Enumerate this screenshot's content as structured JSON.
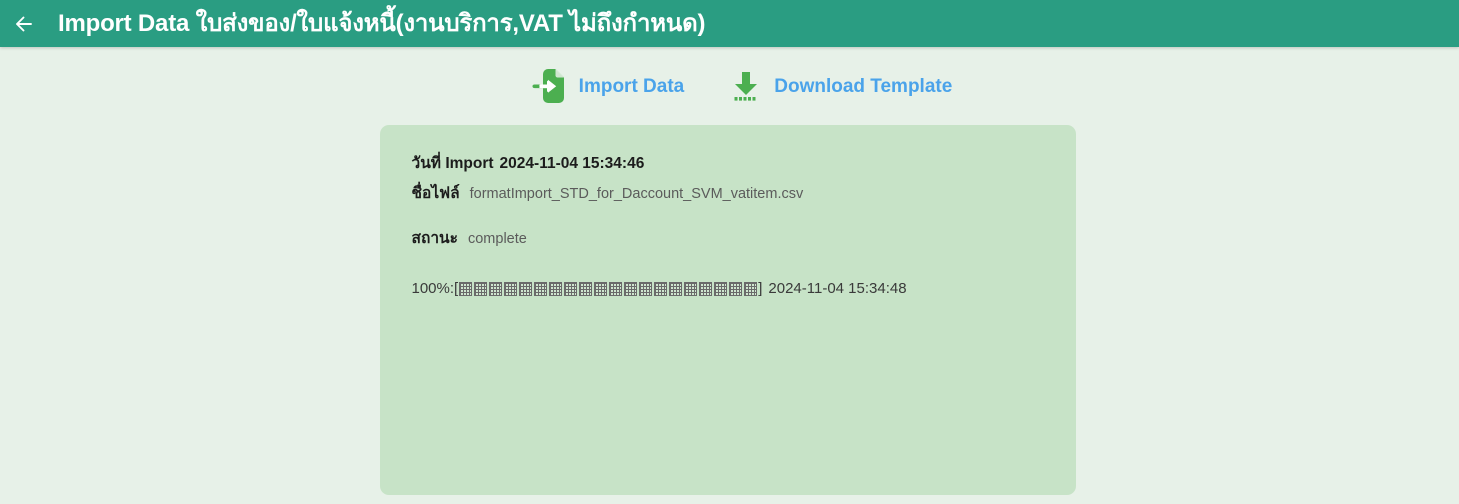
{
  "header": {
    "back_icon": "arrow-left-icon",
    "title": "Import Data ใบส่งของ/ใบแจ้งหนี้(งานบริการ,VAT ไม่ถึงกำหนด)",
    "background_color": "#2a9d82",
    "title_color": "#ffffff"
  },
  "toolbar": {
    "import": {
      "icon": "import-file-icon",
      "label": "Import Data"
    },
    "download": {
      "icon": "download-icon",
      "label": "Download Template"
    },
    "label_color": "#4aa3ea",
    "icon_color": "#4caf50"
  },
  "card": {
    "background_color": "#c7e3c7",
    "fields": [
      {
        "label": "วันที่ Import",
        "value": "2024-11-04 15:34:46",
        "style": "bold"
      },
      {
        "label": "ชื่อไฟล์",
        "value": "formatImport_STD_for_Daccount_SVM_vatitem.csv",
        "style": "muted"
      },
      {
        "label": "สถานะ",
        "value": "complete",
        "style": "muted"
      }
    ],
    "progress": {
      "percent_text": "100%:",
      "bracket_open": "[",
      "bracket_close": "]",
      "blocks": 20,
      "timestamp": "2024-11-04 15:34:48"
    }
  },
  "page": {
    "background_color": "#e7f1e8"
  }
}
